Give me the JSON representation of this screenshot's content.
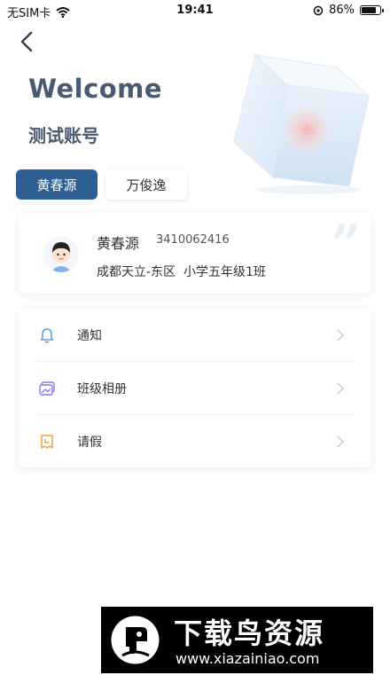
{
  "status": {
    "carrier": "无SIM卡",
    "time": "19:41",
    "battery": "86%",
    "battery_level": 0.86
  },
  "header": {
    "welcome": "Welcome",
    "account": "测试账号"
  },
  "tabs": [
    {
      "label": "黄春源",
      "active": true
    },
    {
      "label": "万俊逸",
      "active": false
    }
  ],
  "student": {
    "name": "黄春源",
    "id": "3410062416",
    "class": "成都天立-东区  小学五年级1班"
  },
  "menu": {
    "items": [
      {
        "label": "通知",
        "icon": "bell-icon"
      },
      {
        "label": "班级相册",
        "icon": "album-icon"
      },
      {
        "label": "请假",
        "icon": "leave-icon"
      }
    ]
  },
  "watermark": {
    "title": "下载鸟资源",
    "url": "www.xiazainiao.com"
  },
  "colors": {
    "accent": "#2e5f92",
    "heading": "#4a5a72"
  }
}
